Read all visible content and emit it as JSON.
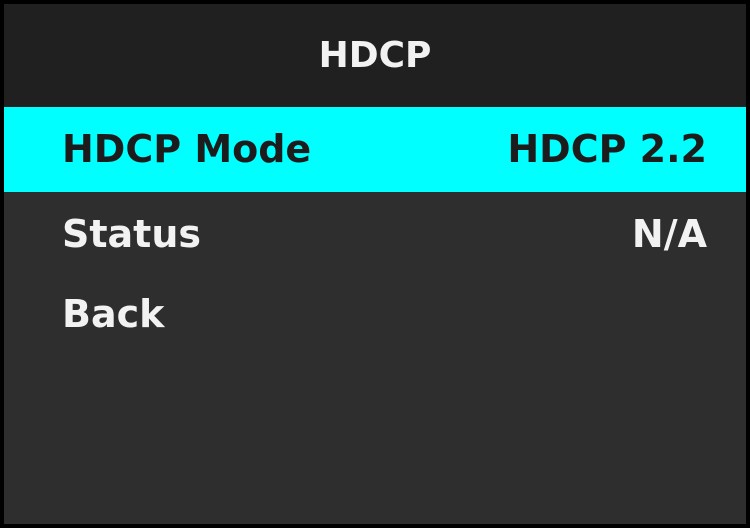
{
  "menu": {
    "title": "HDCP",
    "items": [
      {
        "label": "HDCP Mode",
        "value": "HDCP 2.2",
        "selected": true
      },
      {
        "label": "Status",
        "value": "N/A",
        "selected": false
      },
      {
        "label": "Back",
        "value": "",
        "selected": false
      }
    ]
  },
  "colors": {
    "highlight": "#00ffff",
    "background": "#2e2e2e",
    "title_background": "#202020",
    "text": "#f2f2f2",
    "highlight_text": "#1c1c1c"
  }
}
